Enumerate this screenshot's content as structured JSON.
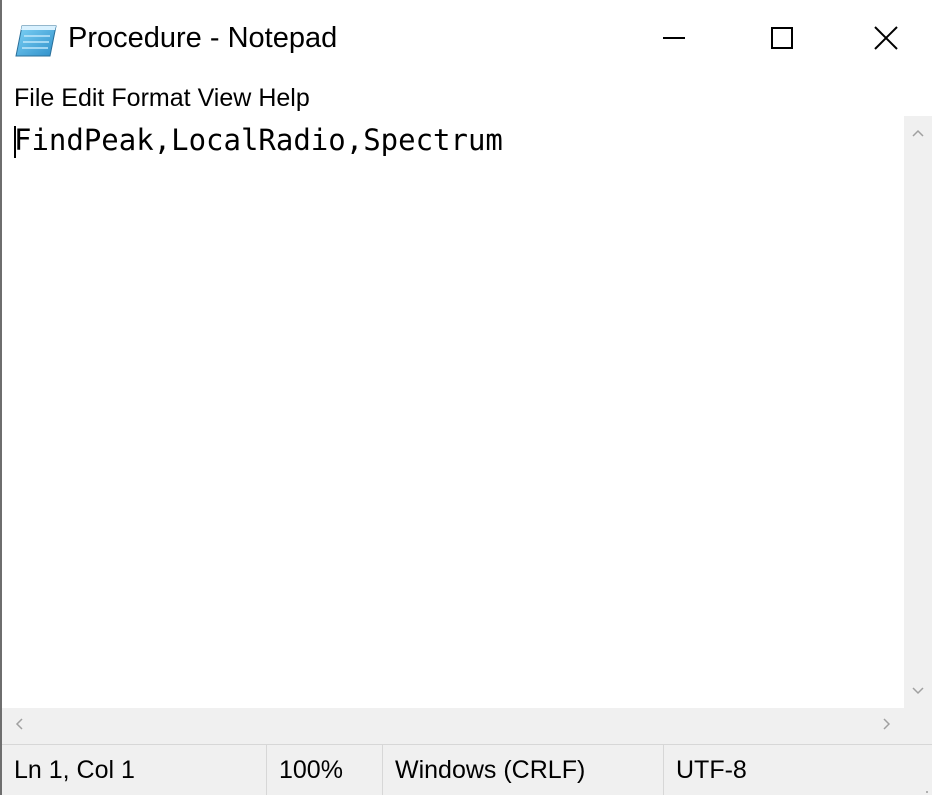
{
  "window": {
    "title": "Procedure - Notepad",
    "icon": "notepad-icon",
    "controls": {
      "minimize_icon": "minimize-icon",
      "maximize_icon": "maximize-icon",
      "close_icon": "close-icon"
    }
  },
  "menu": {
    "items": [
      "File",
      "Edit",
      "Format",
      "View",
      "Help"
    ]
  },
  "editor": {
    "content": "FindPeak,LocalRadio,Spectrum"
  },
  "scrollbars": {
    "vertical": {
      "up_icon": "chevron-up-icon",
      "down_icon": "chevron-down-icon"
    },
    "horizontal": {
      "left_icon": "chevron-left-icon",
      "right_icon": "chevron-right-icon"
    }
  },
  "statusbar": {
    "position": "Ln 1, Col 1",
    "zoom": "100%",
    "line_ending": "Windows (CRLF)",
    "encoding": "UTF-8"
  },
  "colors": {
    "background": "#ffffff",
    "chrome": "#f0f0f0",
    "text": "#000000",
    "scroll_arrow": "#a0a0a0"
  }
}
